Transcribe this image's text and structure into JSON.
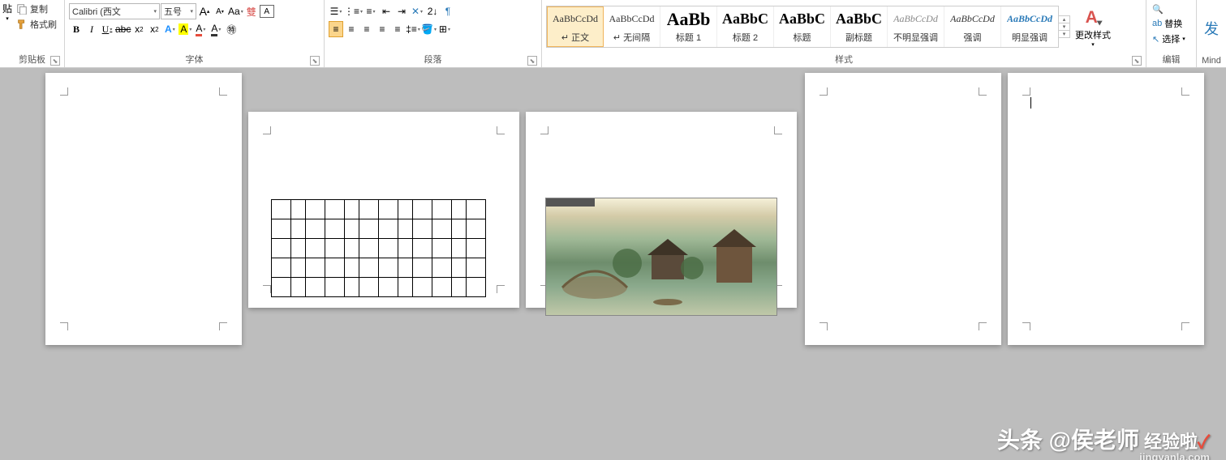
{
  "clipboard": {
    "paste": "贴",
    "copy": "复制",
    "format": "格式刷",
    "label": "剪贴板"
  },
  "font": {
    "name": "Calibri (西文",
    "size": "五号",
    "grow": "A",
    "shrink": "A",
    "clear": "Aa",
    "phonetic": "变",
    "border": "A",
    "bold": "B",
    "italic": "I",
    "underline": "U",
    "strike": "abc",
    "sub": "x₂",
    "sup": "x²",
    "effect": "A",
    "highlight": "A",
    "color": "A",
    "charshade": "A",
    "enclose": "字",
    "label": "字体"
  },
  "para": {
    "label": "段落"
  },
  "styles": {
    "items": [
      {
        "preview": "AaBbCcDd",
        "name": "↵ 正文",
        "cls": "p-normal",
        "sel": true
      },
      {
        "preview": "AaBbCcDd",
        "name": "↵ 无间隔",
        "cls": "p-normal"
      },
      {
        "preview": "AaBb",
        "name": "标题 1",
        "cls": "p-h1"
      },
      {
        "preview": "AaBbC",
        "name": "标题 2",
        "cls": "p-h2"
      },
      {
        "preview": "AaBbC",
        "name": "标题",
        "cls": "p-title"
      },
      {
        "preview": "AaBbC",
        "name": "副标题",
        "cls": "p-sub"
      },
      {
        "preview": "AaBbCcDd",
        "name": "不明显强调",
        "cls": "p-subtle"
      },
      {
        "preview": "AaBbCcDd",
        "name": "强调",
        "cls": "p-em"
      },
      {
        "preview": "AaBbCcDd",
        "name": "明显强调",
        "cls": "p-intense"
      }
    ],
    "change": "更改样式",
    "label": "样式"
  },
  "edit": {
    "find": "查找",
    "replace": "替换",
    "select": "选择",
    "label": "编辑"
  },
  "mind": {
    "label": "Mind"
  },
  "watermark": {
    "brand": "头条 @侯老师",
    "suffix": "经验啦",
    "site": "jingyanla.com"
  }
}
